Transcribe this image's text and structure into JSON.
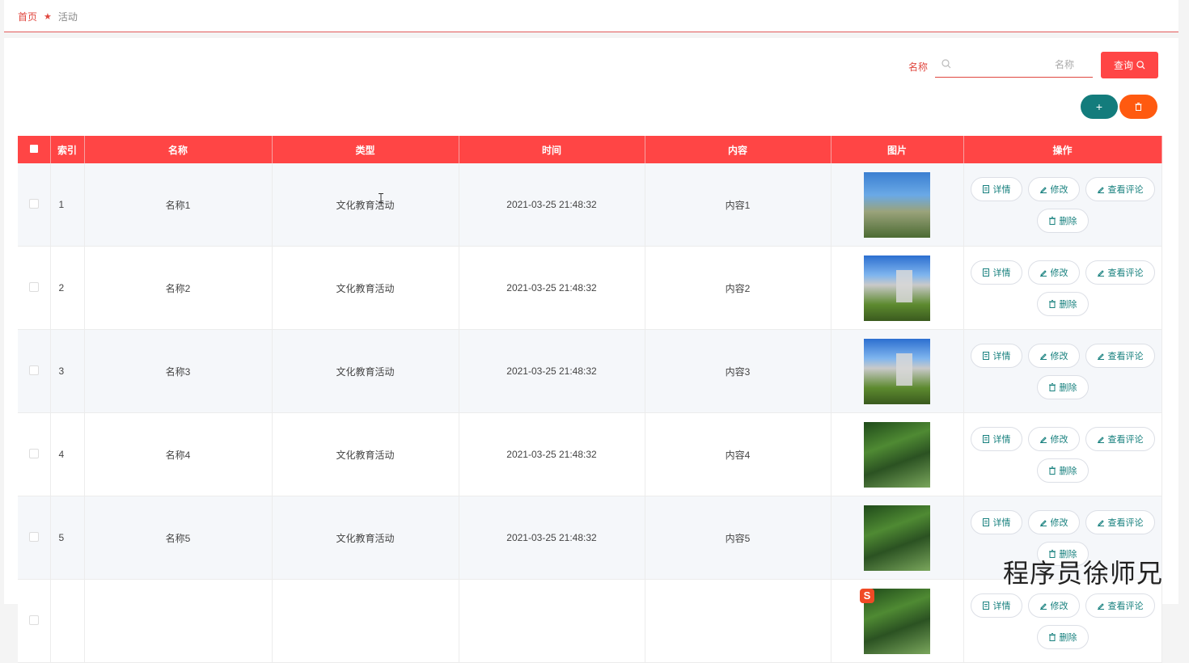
{
  "breadcrumb": {
    "home": "首页",
    "current": "活动"
  },
  "search": {
    "label": "名称",
    "placeholder": "名称",
    "value": ""
  },
  "buttons": {
    "query": "查询",
    "add": "+"
  },
  "table": {
    "headers": [
      "索引",
      "名称",
      "类型",
      "时间",
      "内容",
      "图片",
      "操作"
    ],
    "rows": [
      {
        "index": "1",
        "name": "名称1",
        "type": "文化教育活动",
        "time": "2021-03-25 21:48:32",
        "content": "内容1",
        "image": "a"
      },
      {
        "index": "2",
        "name": "名称2",
        "type": "文化教育活动",
        "time": "2021-03-25 21:48:32",
        "content": "内容2",
        "image": "b"
      },
      {
        "index": "3",
        "name": "名称3",
        "type": "文化教育活动",
        "time": "2021-03-25 21:48:32",
        "content": "内容3",
        "image": "b"
      },
      {
        "index": "4",
        "name": "名称4",
        "type": "文化教育活动",
        "time": "2021-03-25 21:48:32",
        "content": "内容4",
        "image": "c"
      },
      {
        "index": "5",
        "name": "名称5",
        "type": "文化教育活动",
        "time": "2021-03-25 21:48:32",
        "content": "内容5",
        "image": "c"
      },
      {
        "index": "",
        "name": "",
        "type": "",
        "time": "",
        "content": "",
        "image": "c"
      }
    ],
    "actions": {
      "detail": "详情",
      "edit": "修改",
      "comments": "查看评论",
      "delete": "删除"
    }
  },
  "watermark": "程序员徐师兄",
  "colors": {
    "primary": "#ff4545",
    "teal": "#137c7c",
    "orange": "#ff5a10"
  }
}
